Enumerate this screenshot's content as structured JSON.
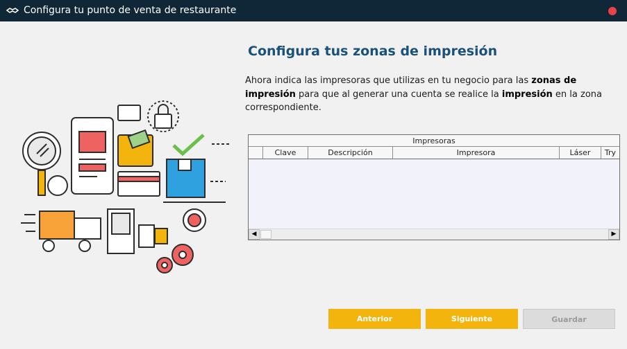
{
  "window": {
    "title": "Configura tu punto de venta de restaurante"
  },
  "main": {
    "heading": "Configura tus zonas de impresión",
    "intro": {
      "p1": "Ahora indica las impresoras que utilizas en tu negocio para las ",
      "b1": "zonas de impresión",
      "p2": " para que al generar una cuenta se realice la ",
      "b2": "impresión",
      "p3": " en la zona correspondiente."
    },
    "grid": {
      "group_header": "Impresoras",
      "columns": [
        "",
        "Clave",
        "Descripción",
        "Impresora",
        "Láser",
        "Try"
      ],
      "rows": []
    }
  },
  "buttons": {
    "anterior": "Anterior",
    "siguiente": "Siguiente",
    "guardar": "Guardar"
  },
  "colors": {
    "titlebar": "#0f2737",
    "heading": "#1a5178",
    "accent": "#f2b40d",
    "close": "#e8424b"
  },
  "icons": {
    "app": "handshake-icon",
    "close": "close-icon"
  }
}
